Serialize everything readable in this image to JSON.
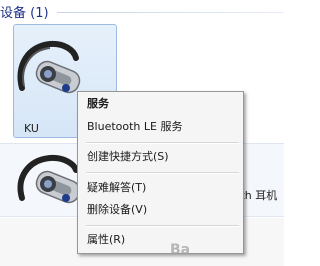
{
  "group": {
    "title": "设备 (1)"
  },
  "device": {
    "label": "KU"
  },
  "row": {
    "label_fragment": "ooth 耳机"
  },
  "context_menu": {
    "items": [
      {
        "label": "服务",
        "bold": true
      },
      {
        "label": "Bluetooth LE 服务",
        "bold": false
      },
      {
        "label": "创建快捷方式(S)",
        "bold": false
      },
      {
        "label": "疑难解答(T)",
        "bold": false
      },
      {
        "label": "删除设备(V)",
        "bold": false
      },
      {
        "label": "属性(R)",
        "bold": false
      }
    ]
  },
  "watermark": {
    "text": "Ba"
  },
  "icons": {
    "device": "bluetooth-headset-icon"
  }
}
